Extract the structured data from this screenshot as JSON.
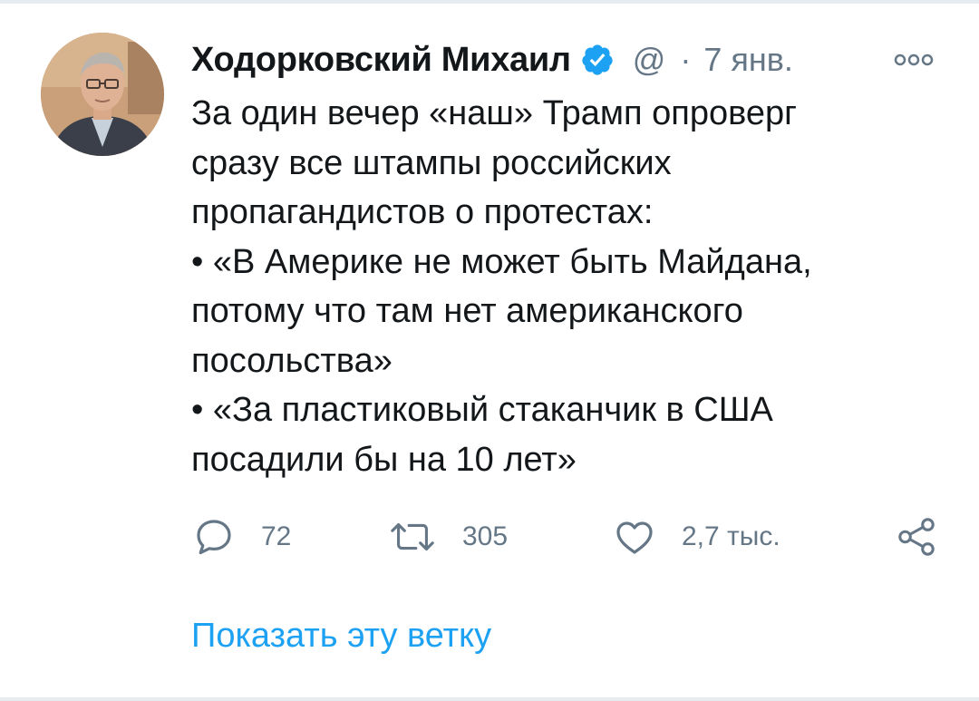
{
  "tweet": {
    "author_name": "Ходорковский Михаил",
    "handle": "@",
    "separator": "·",
    "date": "7 янв.",
    "text_lines": [
      "За один вечер «наш» Трамп опроверг",
      "сразу все штампы российских",
      "пропагандистов о протестах:",
      "• «В Америке не может быть Майдана,",
      "потому что там нет американского",
      "посольства»",
      "• «За пластиковый стаканчик в США",
      "посадили бы на 10 лет»"
    ],
    "actions": {
      "replies": "72",
      "retweets": "305",
      "likes": "2,7 тыс."
    },
    "show_thread": "Показать эту ветку"
  },
  "icons": {
    "avatar": "avatar-photo",
    "verified": "verified-badge-icon",
    "more": "more-options-icon",
    "reply": "reply-icon",
    "retweet": "retweet-icon",
    "like": "heart-icon",
    "share": "share-icon"
  },
  "colors": {
    "text": "#14171a",
    "secondary": "#657786",
    "accent": "#1da1f2",
    "divider": "#e6ecf0"
  }
}
